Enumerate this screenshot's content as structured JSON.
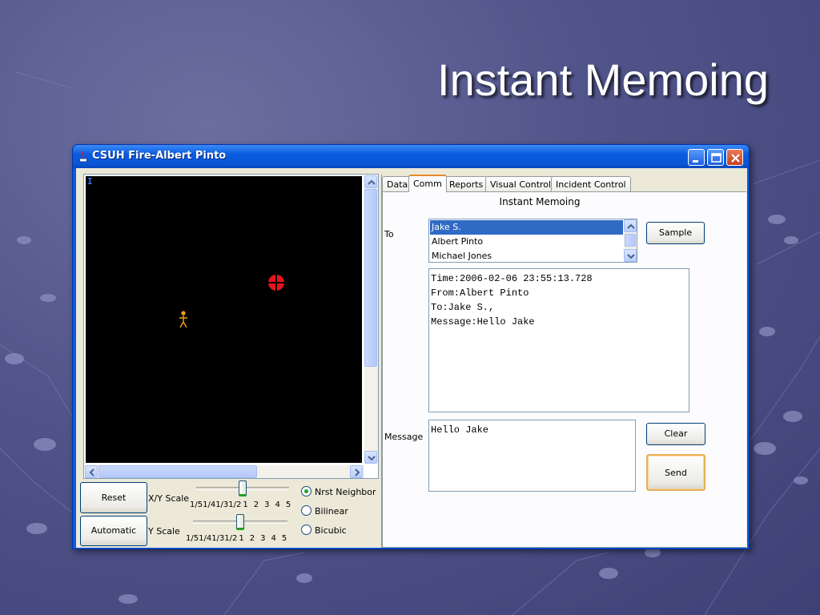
{
  "slide": {
    "title": "Instant Memoing"
  },
  "window": {
    "title": "CSUH Fire-Albert Pinto",
    "controls": [
      "minimize-icon",
      "maximize-icon",
      "close-icon"
    ]
  },
  "map": {
    "corner_marker": "I",
    "markers": [
      "fire-target-icon",
      "person-icon"
    ]
  },
  "left_controls": {
    "reset_label": "Reset",
    "automatic_label": "Automatic",
    "xy_scale_label": "X/Y Scale",
    "y_scale_label": "Y Scale",
    "scale_ticks": [
      "1/5",
      "1/4",
      "1/3",
      "1/2",
      "1",
      "2",
      "3",
      "4",
      "5"
    ],
    "xy_scale_value": "1",
    "y_scale_value": "1",
    "interpolation_options": [
      {
        "label": "Nrst Neighbor",
        "checked": true
      },
      {
        "label": "Bilinear",
        "checked": false
      },
      {
        "label": "Bicubic",
        "checked": false
      }
    ]
  },
  "tabs": [
    {
      "label": "Data",
      "active": false
    },
    {
      "label": "Comm",
      "active": true
    },
    {
      "label": "Reports",
      "active": false
    },
    {
      "label": "Visual Control",
      "active": false
    },
    {
      "label": "Incident Control",
      "active": false
    }
  ],
  "comm": {
    "heading": "Instant Memoing",
    "to_label": "To",
    "recipients": [
      {
        "name": "Jake S.",
        "selected": true
      },
      {
        "name": "Albert Pinto",
        "selected": false
      },
      {
        "name": "Michael Jones",
        "selected": false
      }
    ],
    "sample_label": "Sample",
    "log_lines": [
      "Time:2006-02-06 23:55:13.728",
      "From:Albert Pinto",
      "To:Jake S.,",
      "Message:Hello Jake"
    ],
    "message_label": "Message",
    "message_value": "Hello Jake",
    "clear_label": "Clear",
    "send_label": "Send"
  },
  "colors": {
    "slide_background": "#50548a",
    "title_bar": "#0a5ce0",
    "selection": "#316ac5",
    "fire_marker": "#e8141c",
    "person_marker": "#f0a020"
  }
}
